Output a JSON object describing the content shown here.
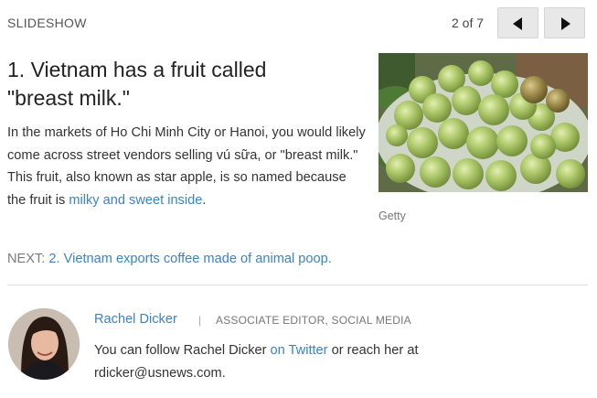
{
  "header": {
    "section_label": "SLIDESHOW",
    "counter": "2 of 7",
    "prev_icon": "triangle-left-icon",
    "next_icon": "triangle-right-icon"
  },
  "slide": {
    "headline_line1": "1. Vietnam has a fruit called",
    "headline_line2": "\"breast milk.\"",
    "body_before_link": "In the markets of Ho Chi Minh City or Hanoi, you would likely come across street vendors selling vú sữa, or \"breast milk.\" This fruit, also known as star apple, is so named because the fruit is ",
    "body_link": "milky and sweet inside",
    "body_after_link": ".",
    "photo_credit": "Getty"
  },
  "next": {
    "prefix": "NEXT:",
    "link": "2. Vietnam exports coffee made of animal poop."
  },
  "author": {
    "name": "Rachel Dicker",
    "separator": "|",
    "title": "ASSOCIATE EDITOR, SOCIAL MEDIA",
    "bio_before_link": "You can follow Rachel Dicker ",
    "bio_link": "on Twitter",
    "bio_after_link": " or reach her at rdicker@usnews.com."
  },
  "colors": {
    "link": "#3c82c4",
    "button_bg": "#e8e8e8",
    "fruit_green": "#a9c46a"
  }
}
